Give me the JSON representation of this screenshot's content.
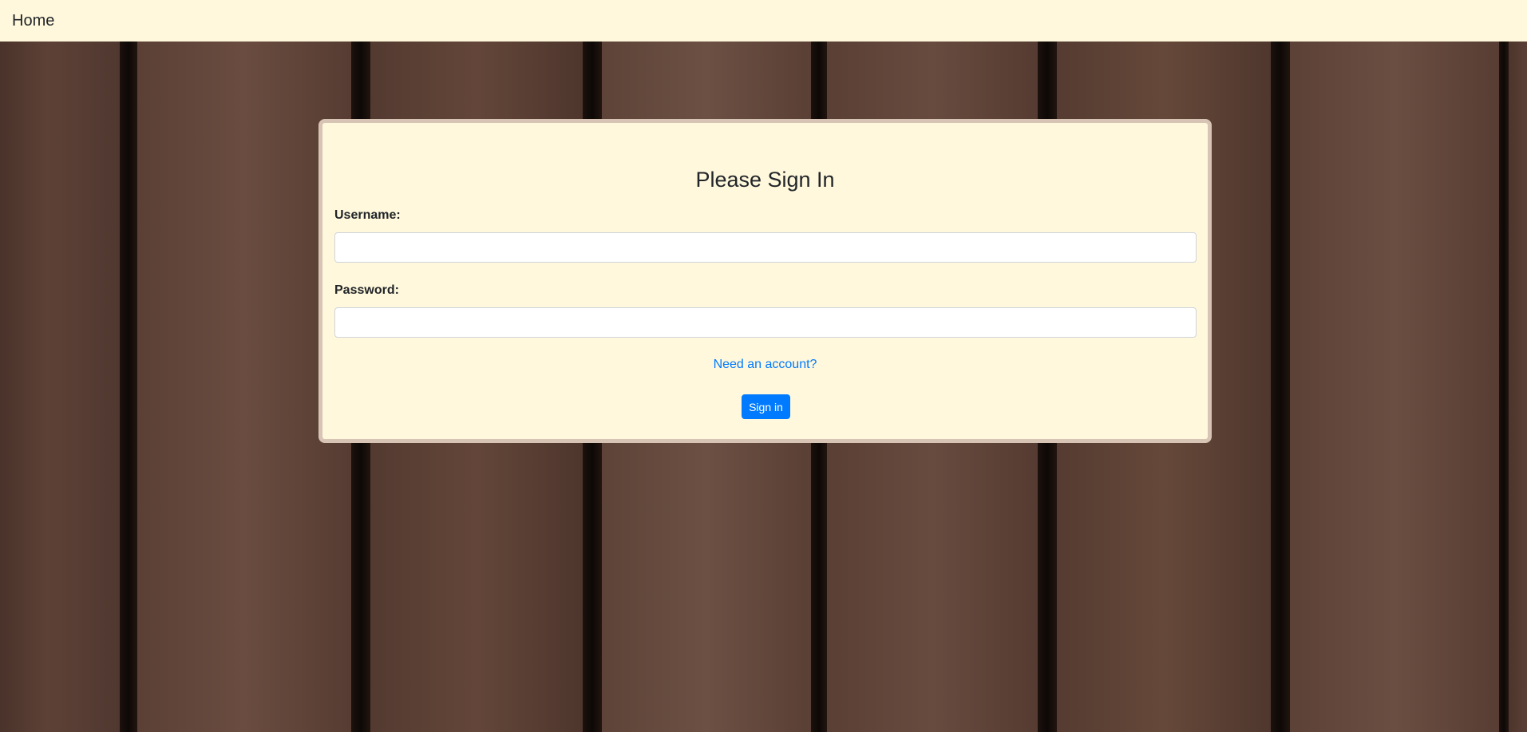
{
  "navbar": {
    "brand_label": "Home"
  },
  "login_form": {
    "title": "Please Sign In",
    "username_label": "Username:",
    "username_value": "",
    "password_label": "Password:",
    "password_value": "",
    "register_link_label": "Need an account?",
    "submit_label": "Sign in"
  },
  "colors": {
    "navbar_background": "#fff8dc",
    "card_background": "#fff8dc",
    "link": "#007bff",
    "primary_button": "#007bff",
    "background_wood": "#5a3f35"
  }
}
